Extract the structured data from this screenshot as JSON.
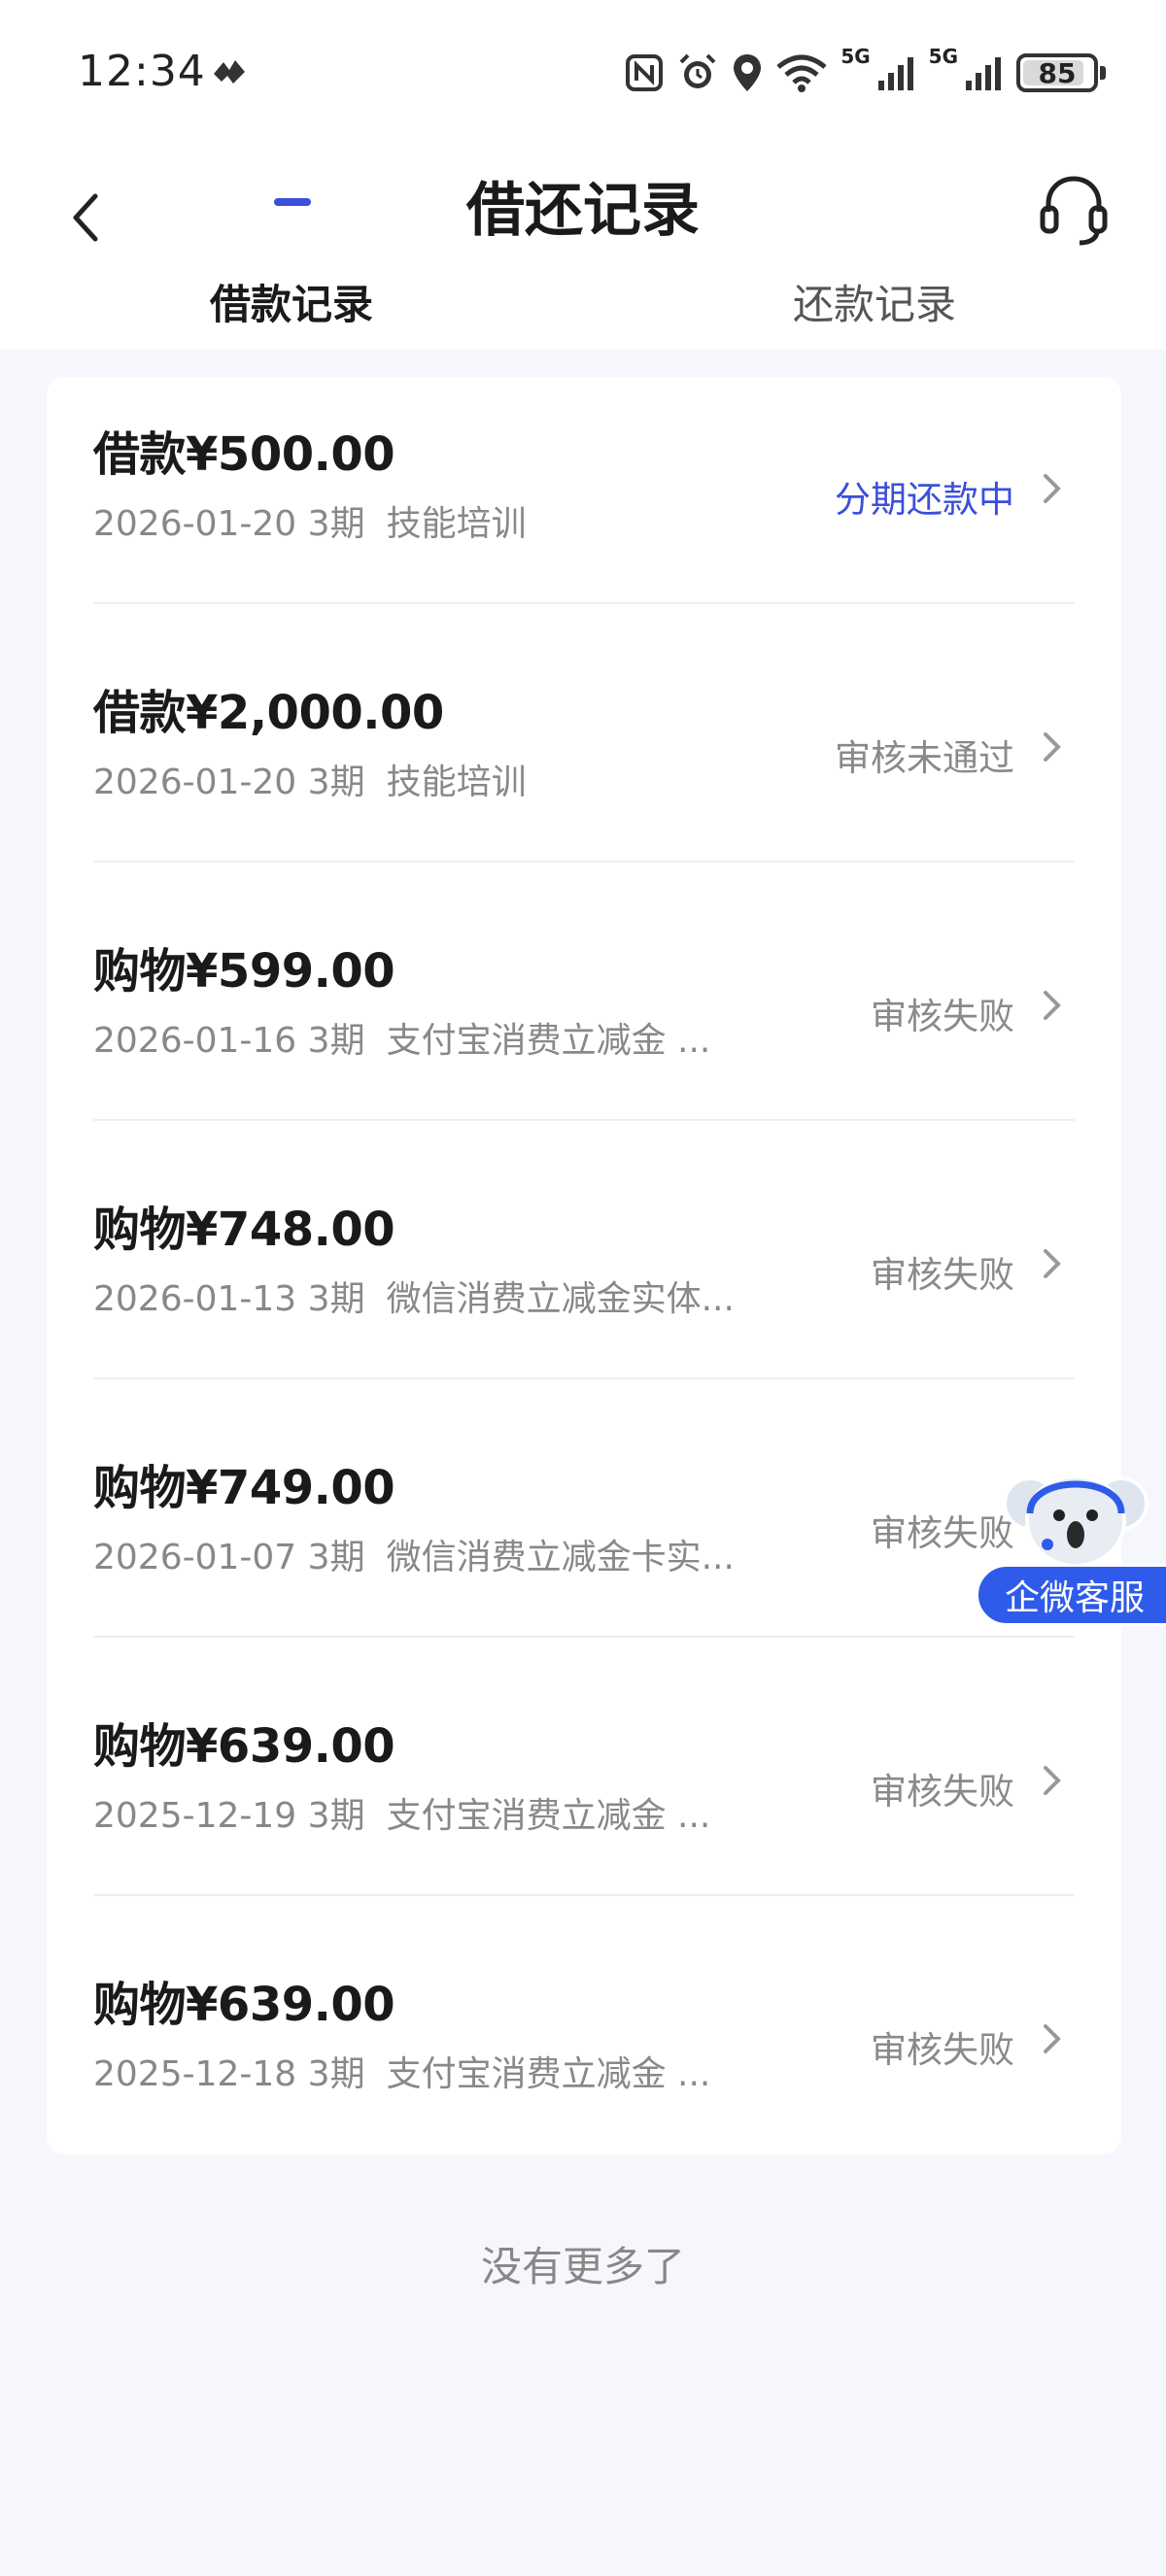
{
  "status_bar": {
    "time": "12:34",
    "network_labels": [
      "5G",
      "5G"
    ],
    "battery": "85"
  },
  "header": {
    "title": "借还记录",
    "tabs": [
      {
        "label": "借款记录",
        "active": true
      },
      {
        "label": "还款记录",
        "active": false
      }
    ]
  },
  "records": [
    {
      "type": "借款",
      "amount": "¥500.00",
      "date": "2026-01-20",
      "term": "3期",
      "purpose": "技能培训",
      "status": "分期还款中",
      "status_color": "#3b4fd9"
    },
    {
      "type": "借款",
      "amount": "¥2,000.00",
      "date": "2026-01-20",
      "term": "3期",
      "purpose": "技能培训",
      "status": "审核未通过",
      "status_color": "#8a8a8a"
    },
    {
      "type": "购物",
      "amount": "¥599.00",
      "date": "2026-01-16",
      "term": "3期",
      "purpose": "支付宝消费立减金 ...",
      "status": "审核失败",
      "status_color": "#8a8a8a"
    },
    {
      "type": "购物",
      "amount": "¥748.00",
      "date": "2026-01-13",
      "term": "3期",
      "purpose": "微信消费立减金实体...",
      "status": "审核失败",
      "status_color": "#8a8a8a"
    },
    {
      "type": "购物",
      "amount": "¥749.00",
      "date": "2026-01-07",
      "term": "3期",
      "purpose": "微信消费立减金卡实...",
      "status": "审核失败",
      "status_color": "#8a8a8a"
    },
    {
      "type": "购物",
      "amount": "¥639.00",
      "date": "2025-12-19",
      "term": "3期",
      "purpose": "支付宝消费立减金 ...",
      "status": "审核失败",
      "status_color": "#8a8a8a"
    },
    {
      "type": "购物",
      "amount": "¥639.00",
      "date": "2025-12-18",
      "term": "3期",
      "purpose": "支付宝消费立减金 ...",
      "status": "审核失败",
      "status_color": "#8a8a8a"
    }
  ],
  "footer": {
    "no_more": "没有更多了"
  },
  "floating_service": {
    "label": "企微客服"
  },
  "colors": {
    "accent": "#3b4fd9",
    "background": "#f6f7fc"
  }
}
